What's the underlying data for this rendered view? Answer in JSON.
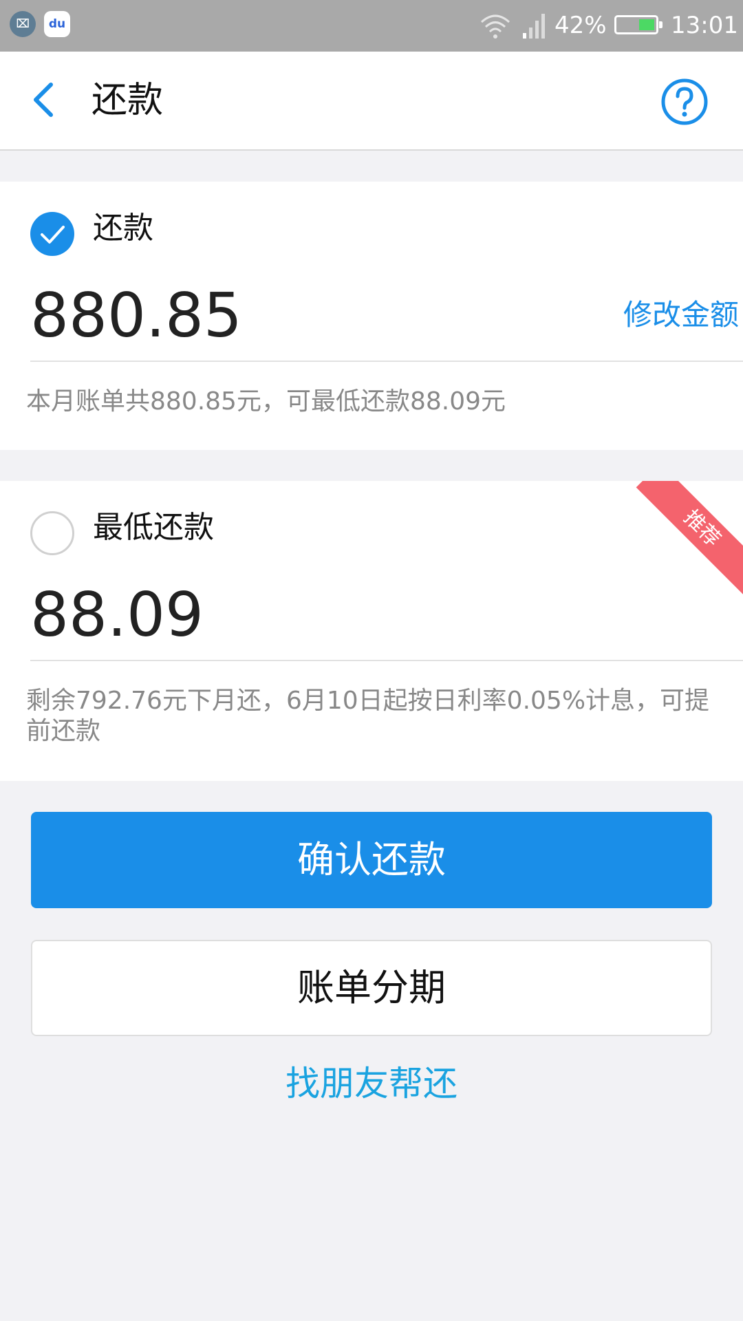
{
  "status_bar": {
    "app_icons": [
      "gallery-icon",
      "baidu-icon"
    ],
    "app_icon_glyphs": [
      "⌧",
      "du"
    ],
    "battery_percent": "42%",
    "battery_level": 0.42,
    "time": "13:01",
    "colors": {
      "background": "#a9a9a9",
      "battery_fill": "#4cd964"
    }
  },
  "header": {
    "back_icon": "chevron-left-icon",
    "title": "还款",
    "help_icon": "question-circle-icon"
  },
  "options": [
    {
      "label": "还款",
      "selected": true,
      "amount": "880.85",
      "modify_link": "修改金额",
      "note": "本月账单共880.85元，可最低还款88.09元"
    },
    {
      "label": "最低还款",
      "selected": false,
      "amount": "88.09",
      "badge": "推荐",
      "note": "剩余792.76元下月还，6月10日起按日利率0.05%计息，可提前还款"
    }
  ],
  "actions": {
    "confirm": "确认还款",
    "installment": "账单分期",
    "friend_help": "找朋友帮还"
  },
  "colors": {
    "accent": "#1a8ee8",
    "badge": "#f4636d",
    "link": "#1aa3e0",
    "page_background": "#f2f2f5"
  }
}
